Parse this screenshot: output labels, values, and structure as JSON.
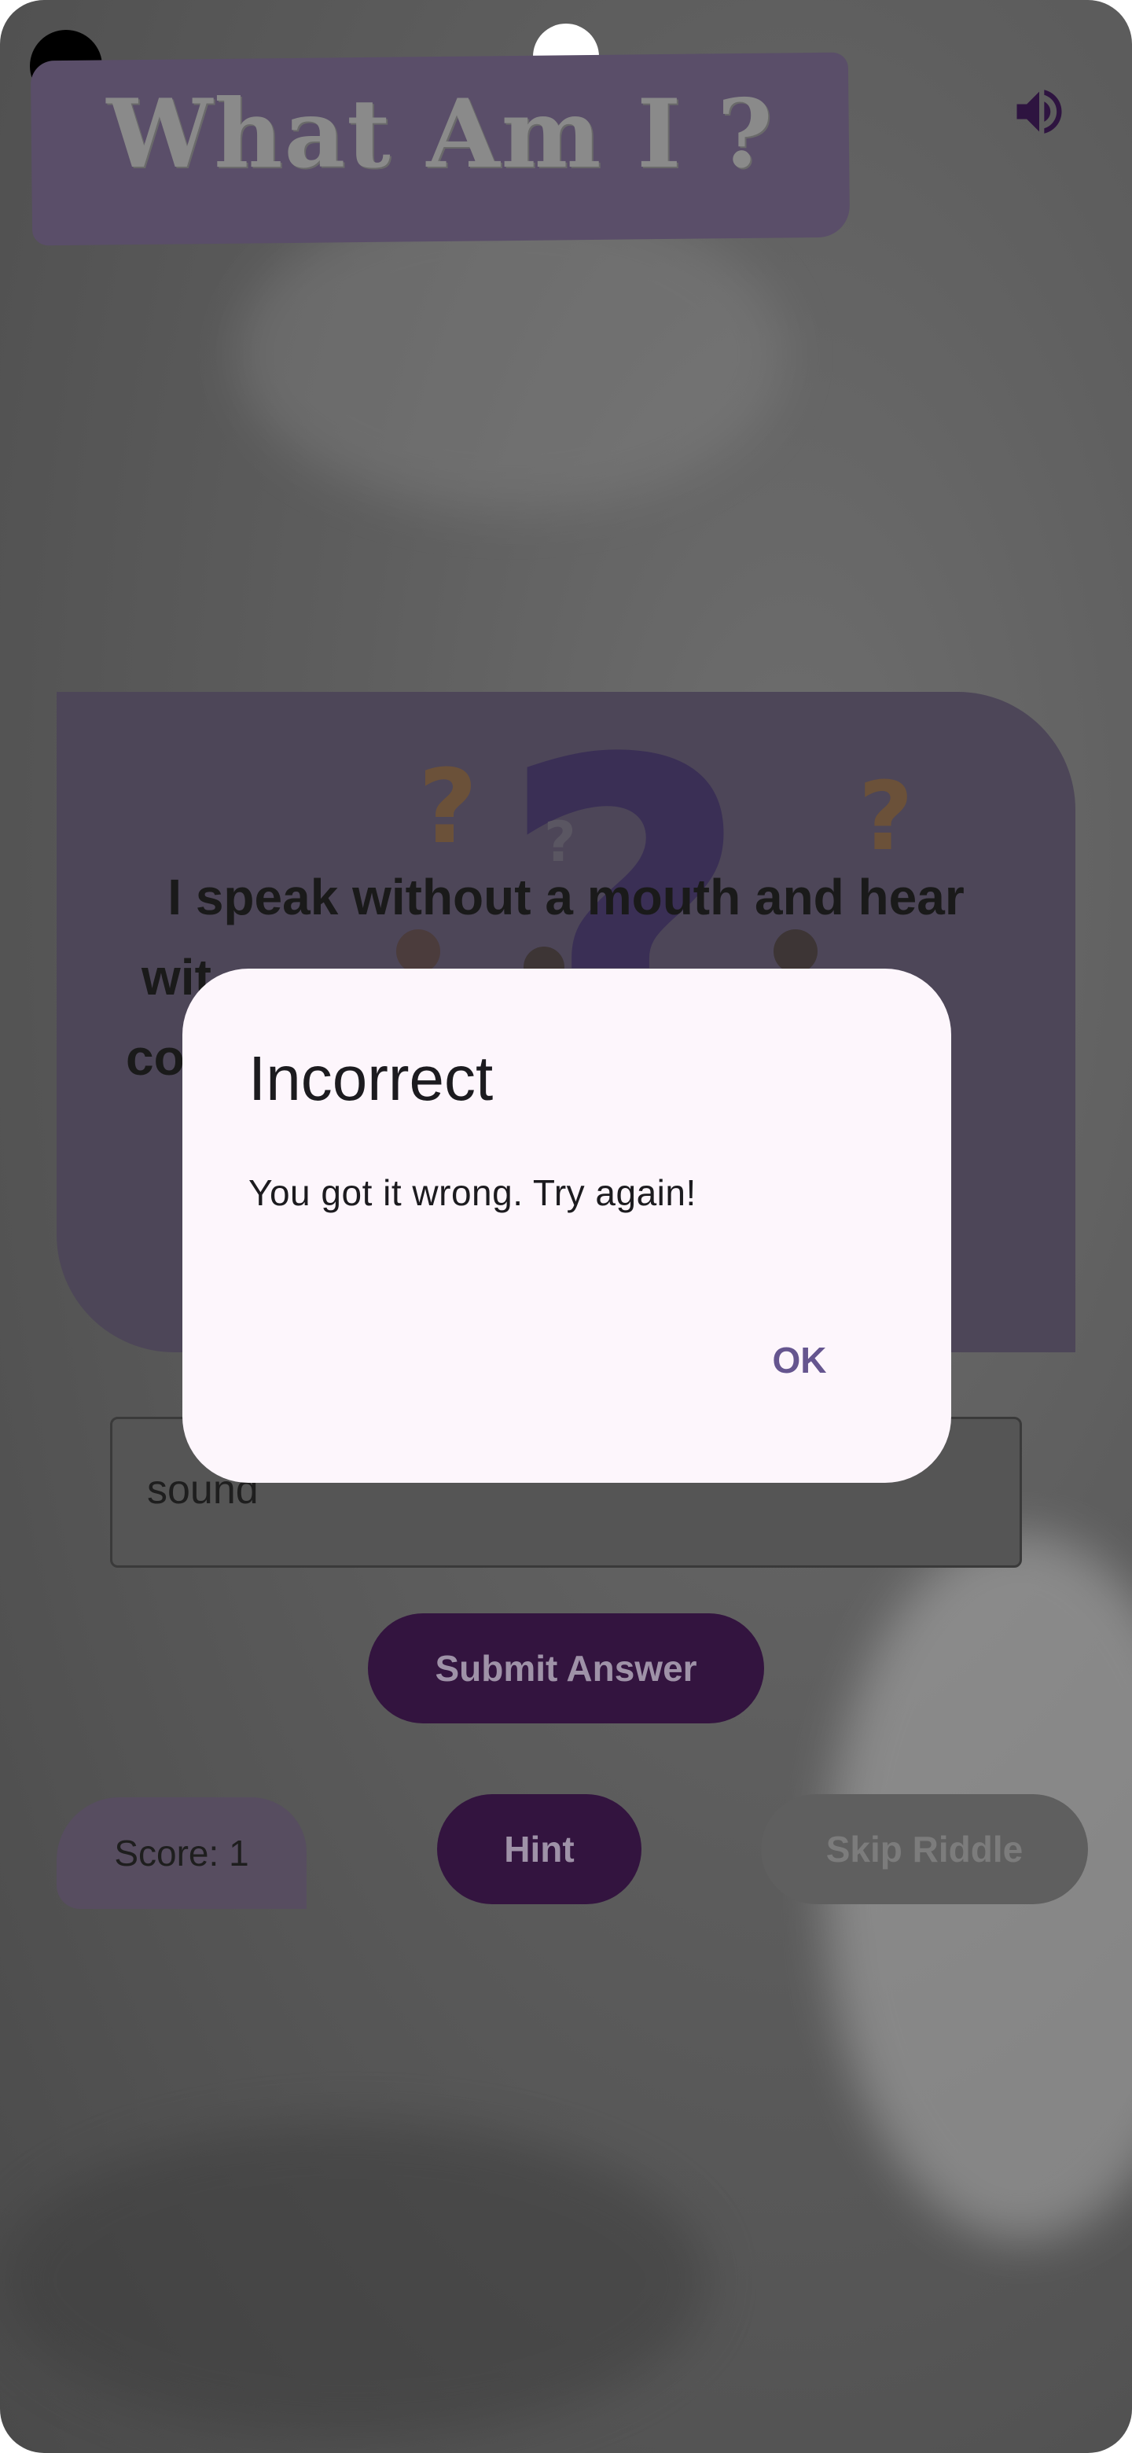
{
  "app": {
    "title": "What Am I ?",
    "sound_icon": "volume-up-icon"
  },
  "riddle": {
    "text": "I speak without a mouth and hear without ears. I have no body, but I come alive with wind. What am I?",
    "visible_lines": [
      "I speak without a mouth and hear",
      "wit",
      "co"
    ]
  },
  "answer": {
    "value": "sound"
  },
  "buttons": {
    "submit": "Submit Answer",
    "hint": "Hint",
    "skip": "Skip Riddle"
  },
  "score": {
    "label": "Score: 1"
  },
  "dialog": {
    "title": "Incorrect",
    "message": "You got it wrong. Try again!",
    "ok": "OK"
  },
  "colors": {
    "primary_dark": "#33143f",
    "dialog_bg": "#fdf6fc",
    "accent_text": "#65558f",
    "banner": "#5a4e69"
  }
}
